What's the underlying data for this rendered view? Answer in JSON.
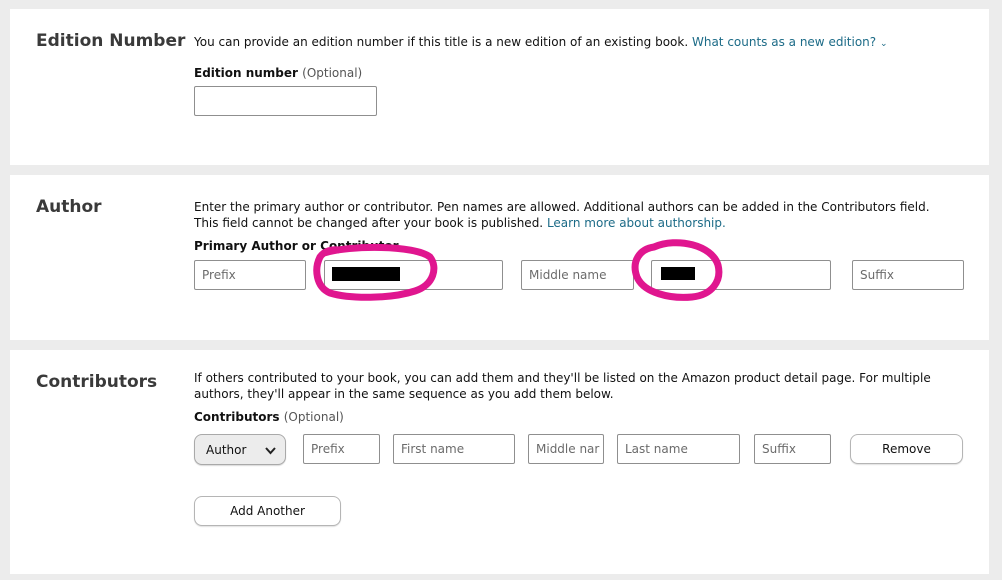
{
  "edition": {
    "title": "Edition Number",
    "description": "You can provide an edition number if this title is a new edition of an existing book.",
    "link": "What counts as a new edition?",
    "field_label": "Edition number",
    "optional": "(Optional)",
    "value": ""
  },
  "author": {
    "title": "Author",
    "description": "Enter the primary author or contributor. Pen names are allowed. Additional authors can be added in the Contributors field. This field cannot be changed after your book is published.",
    "link": "Learn more about authorship.",
    "field_label": "Primary Author or Contributor",
    "prefix_placeholder": "Prefix",
    "middle_placeholder": "Middle name",
    "suffix_placeholder": "Suffix"
  },
  "contributors": {
    "title": "Contributors",
    "description": "If others contributed to your book, you can add them and they'll be listed on the Amazon product detail page. For multiple authors, they'll appear in the same sequence as you add them below.",
    "field_label": "Contributors",
    "optional": "(Optional)",
    "role_selected": "Author",
    "prefix_placeholder": "Prefix",
    "first_placeholder": "First name",
    "middle_placeholder": "Middle nar",
    "last_placeholder": "Last name",
    "suffix_placeholder": "Suffix",
    "remove_label": "Remove",
    "add_another_label": "Add Another"
  },
  "colors": {
    "link": "#1c6b87",
    "annotation": "#e0168f",
    "background": "#ececec"
  }
}
